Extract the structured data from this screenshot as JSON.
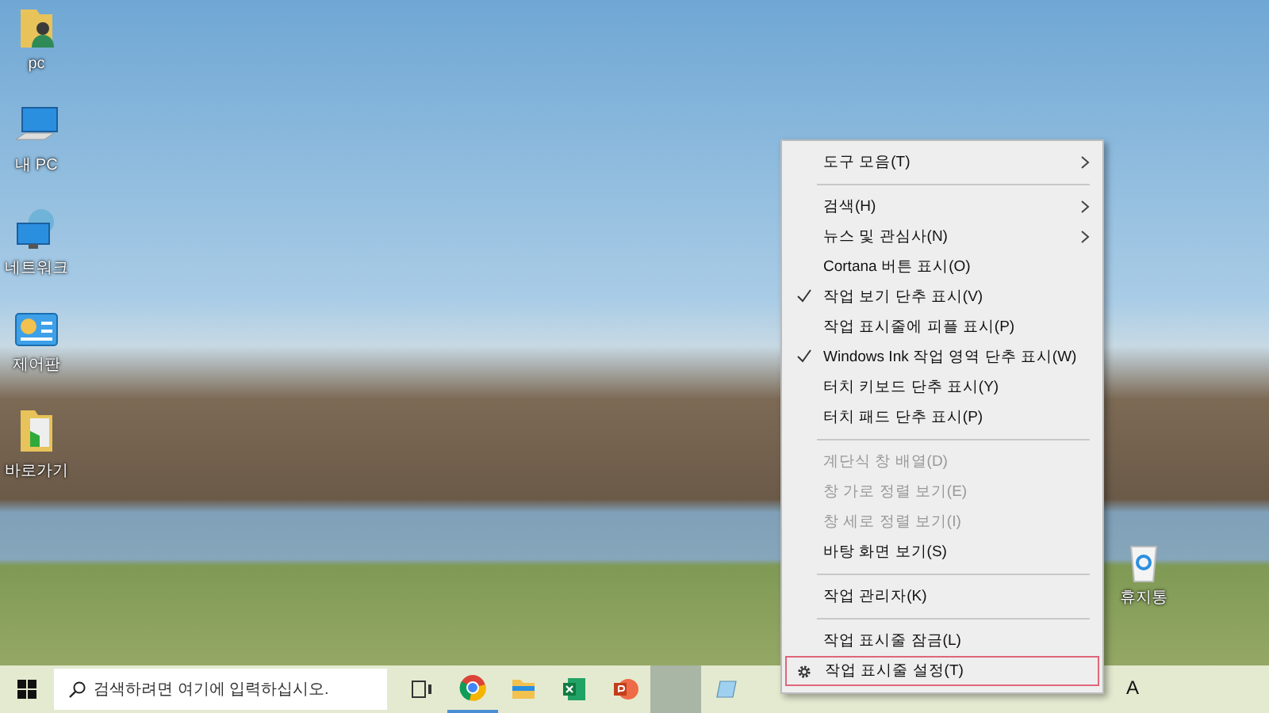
{
  "desktop_icons": [
    {
      "label": "pc",
      "kind": "user-folder"
    },
    {
      "label": "내 PC",
      "kind": "computer"
    },
    {
      "label": "네트워크",
      "kind": "network"
    },
    {
      "label": "제어판",
      "kind": "control-panel"
    },
    {
      "label": "바로가기",
      "kind": "shortcut-folder"
    }
  ],
  "recycle_bin": {
    "label": "휴지통"
  },
  "context_menu": {
    "items": [
      {
        "kind": "item",
        "label": "도구 모음(T)",
        "checked": false,
        "disabled": false,
        "submenu": true,
        "outlined": false
      },
      {
        "kind": "separator"
      },
      {
        "kind": "item",
        "label": "검색(H)",
        "checked": false,
        "disabled": false,
        "submenu": true,
        "outlined": false
      },
      {
        "kind": "item",
        "label": "뉴스 및 관심사(N)",
        "checked": false,
        "disabled": false,
        "submenu": true,
        "outlined": false
      },
      {
        "kind": "item",
        "label": "Cortana 버튼 표시(O)",
        "checked": false,
        "disabled": false,
        "submenu": false,
        "outlined": false
      },
      {
        "kind": "item",
        "label": "작업 보기 단추 표시(V)",
        "checked": true,
        "disabled": false,
        "submenu": false,
        "outlined": false
      },
      {
        "kind": "item",
        "label": "작업 표시줄에 피플 표시(P)",
        "checked": false,
        "disabled": false,
        "submenu": false,
        "outlined": false
      },
      {
        "kind": "item",
        "label": "Windows Ink 작업 영역 단추 표시(W)",
        "checked": true,
        "disabled": false,
        "submenu": false,
        "outlined": false
      },
      {
        "kind": "item",
        "label": "터치 키보드 단추 표시(Y)",
        "checked": false,
        "disabled": false,
        "submenu": false,
        "outlined": false
      },
      {
        "kind": "item",
        "label": "터치 패드 단추 표시(P)",
        "checked": false,
        "disabled": false,
        "submenu": false,
        "outlined": false
      },
      {
        "kind": "separator"
      },
      {
        "kind": "item",
        "label": "계단식 창 배열(D)",
        "checked": false,
        "disabled": true,
        "submenu": false,
        "outlined": false
      },
      {
        "kind": "item",
        "label": "창 가로 정렬 보기(E)",
        "checked": false,
        "disabled": true,
        "submenu": false,
        "outlined": false
      },
      {
        "kind": "item",
        "label": "창 세로 정렬 보기(I)",
        "checked": false,
        "disabled": true,
        "submenu": false,
        "outlined": false
      },
      {
        "kind": "item",
        "label": "바탕 화면 보기(S)",
        "checked": false,
        "disabled": false,
        "submenu": false,
        "outlined": false
      },
      {
        "kind": "separator"
      },
      {
        "kind": "item",
        "label": "작업 관리자(K)",
        "checked": false,
        "disabled": false,
        "submenu": false,
        "outlined": false
      },
      {
        "kind": "separator"
      },
      {
        "kind": "item",
        "label": "작업 표시줄 잠금(L)",
        "checked": false,
        "disabled": false,
        "submenu": false,
        "outlined": false
      },
      {
        "kind": "settings",
        "label": "작업 표시줄 설정(T)",
        "checked": false,
        "disabled": false,
        "submenu": false,
        "outlined": true
      }
    ]
  },
  "taskbar": {
    "search": {
      "placeholder": "검색하려면 여기에 입력하십시오."
    },
    "apps": [
      {
        "kind": "task-view",
        "selected": false
      },
      {
        "kind": "chrome",
        "selected": true
      },
      {
        "kind": "explorer",
        "selected": false
      },
      {
        "kind": "excel",
        "selected": false
      },
      {
        "kind": "powerpoint",
        "selected": false
      },
      {
        "kind": "blank",
        "selected": false
      },
      {
        "kind": "notepad",
        "selected": false
      }
    ],
    "input_indicator": "A"
  }
}
